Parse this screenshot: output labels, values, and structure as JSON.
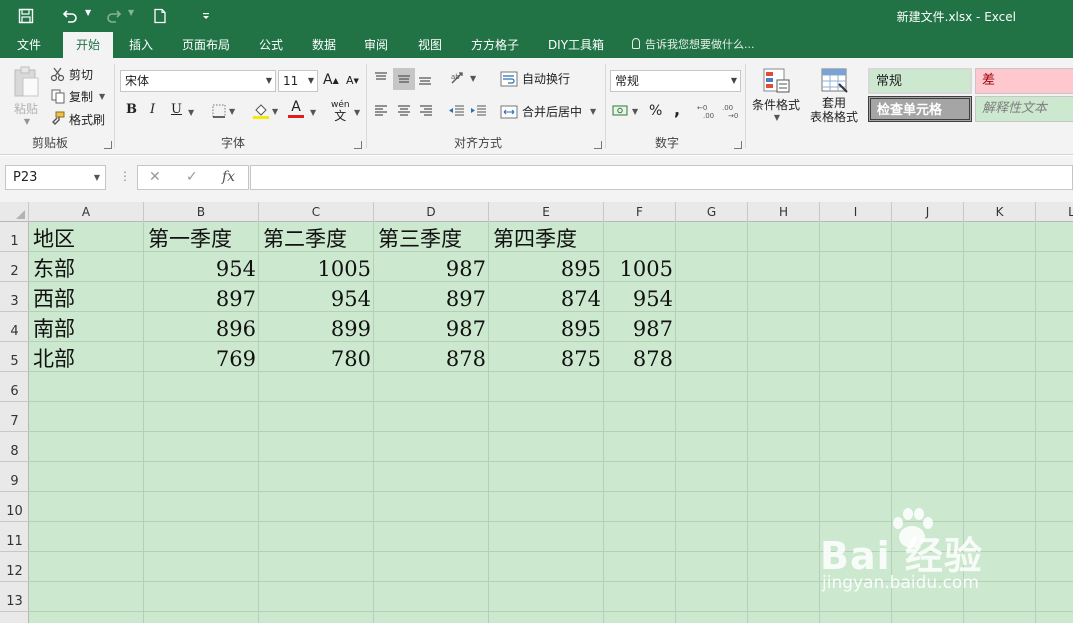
{
  "window": {
    "title": "新建文件.xlsx - Excel"
  },
  "quick_access": {
    "icons": [
      "save-icon",
      "undo-icon",
      "redo-icon",
      "new-file-icon",
      "customize-icon"
    ]
  },
  "tabs": [
    {
      "label": "文件"
    },
    {
      "label": "开始",
      "active": true
    },
    {
      "label": "插入"
    },
    {
      "label": "页面布局"
    },
    {
      "label": "公式"
    },
    {
      "label": "数据"
    },
    {
      "label": "审阅"
    },
    {
      "label": "视图"
    },
    {
      "label": "方方格子"
    },
    {
      "label": "DIY工具箱"
    }
  ],
  "tell_me": "告诉我您想要做什么...",
  "ribbon": {
    "clipboard": {
      "label": "剪贴板",
      "paste": "粘贴",
      "cut": "剪切",
      "copy": "复制",
      "format_painter": "格式刷"
    },
    "font": {
      "label": "字体",
      "font_name": "宋体",
      "font_size": "11",
      "grow": "A",
      "shrink": "A",
      "bold": "B",
      "italic": "I",
      "underline": "U",
      "font_color": "A",
      "phonetic": "wén"
    },
    "alignment": {
      "label": "对齐方式",
      "wrap_text": "自动换行",
      "merge_center": "合并后居中"
    },
    "number": {
      "label": "数字",
      "format": "常规",
      "percent": "%",
      "comma": ","
    },
    "styles": {
      "conditional_format": "条件格式",
      "table_format_line1": "套用",
      "table_format_line2": "表格格式",
      "normal": "常规",
      "bad": "差",
      "check_cell": "检查单元格",
      "explanatory": "解释性文本"
    },
    "colors": {
      "accent": "#217346",
      "sheet_bg": "#cce8cf",
      "bad_bg": "#ffc7ce",
      "bad_text": "#9c0006"
    }
  },
  "formula_bar": {
    "name_box": "P23",
    "cancel": "✕",
    "enter": "✓",
    "fx": "fx",
    "formula": ""
  },
  "sheet": {
    "columns": [
      "A",
      "B",
      "C",
      "D",
      "E",
      "F",
      "G",
      "H",
      "I",
      "J",
      "K",
      "L"
    ],
    "rows": [
      "1",
      "2",
      "3",
      "4",
      "5",
      "6",
      "7",
      "8",
      "9",
      "10",
      "11",
      "12",
      "13"
    ],
    "header": [
      "地区",
      "第一季度",
      "第二季度",
      "第三季度",
      "第四季度",
      ""
    ],
    "data": [
      [
        "东部",
        "954",
        "1005",
        "987",
        "895",
        "1005"
      ],
      [
        "西部",
        "897",
        "954",
        "897",
        "874",
        "954"
      ],
      [
        "南部",
        "896",
        "899",
        "987",
        "895",
        "987"
      ],
      [
        "北部",
        "769",
        "780",
        "878",
        "875",
        "878"
      ]
    ]
  },
  "watermark": {
    "logo": "Bai  经验",
    "url": "jingyan.baidu.com"
  }
}
